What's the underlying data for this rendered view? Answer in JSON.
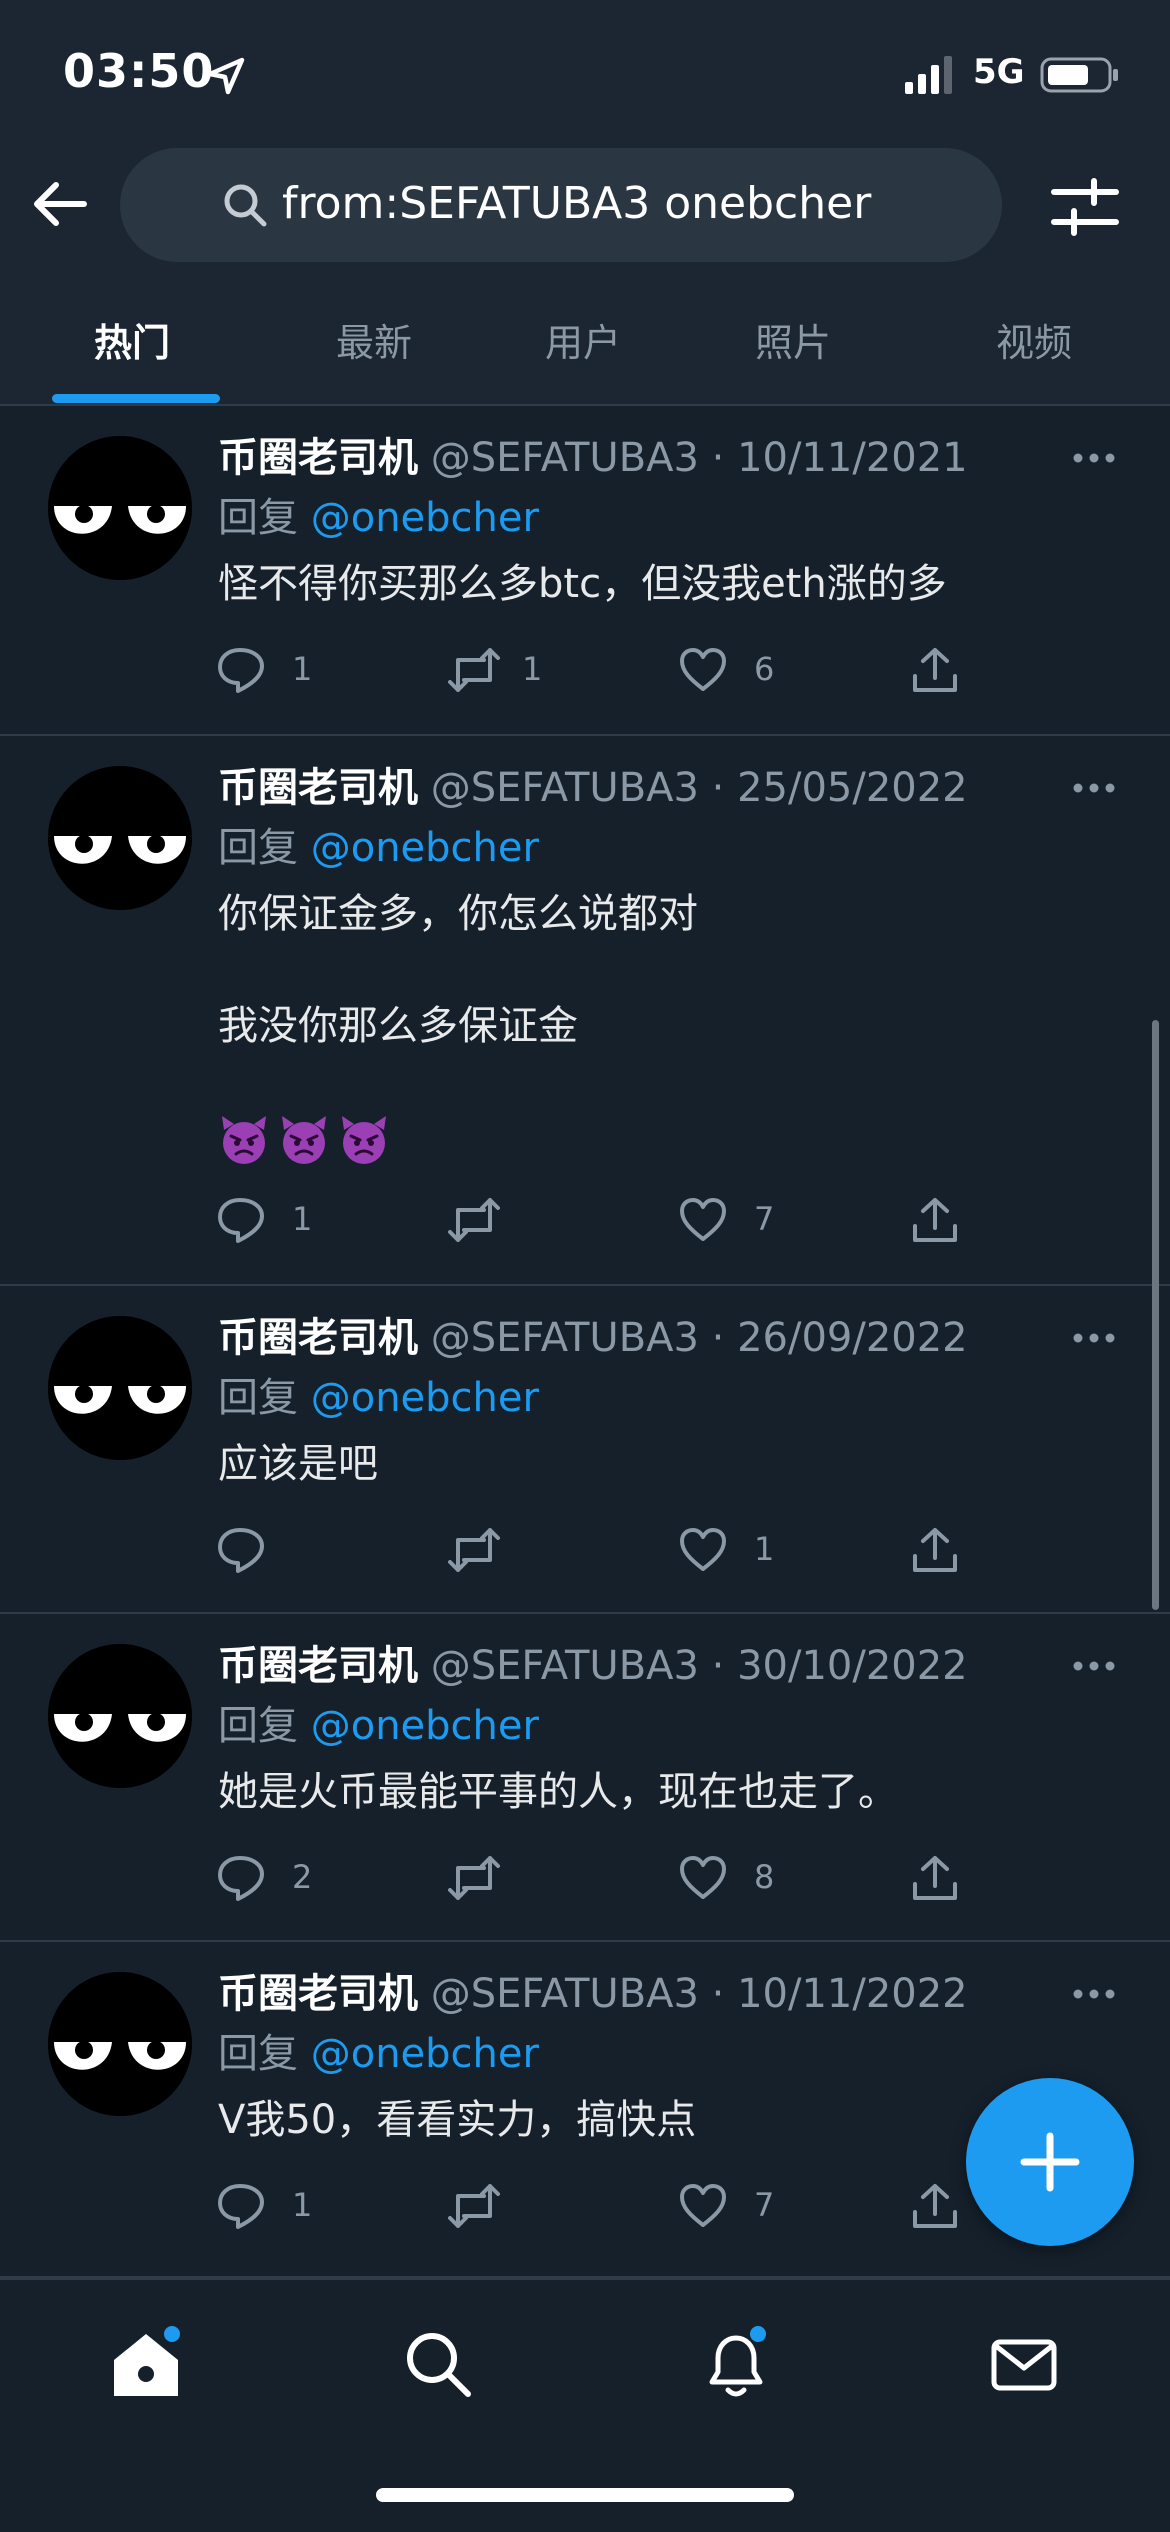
{
  "status_bar": {
    "time": "03:50",
    "network": "5G"
  },
  "search": {
    "query": "from:SEFATUBA3 onebcher"
  },
  "tabs": [
    {
      "label": "热门",
      "active": true
    },
    {
      "label": "最新",
      "active": false
    },
    {
      "label": "用户",
      "active": false
    },
    {
      "label": "照片",
      "active": false
    },
    {
      "label": "视频",
      "active": false
    }
  ],
  "tweets": [
    {
      "display_name": "币圈老司机",
      "meta": "@SEFATUBA3 · 10/11/2021",
      "reply_prefix": "回复",
      "reply_to": "@onebcher",
      "text": [
        "怪不得你买那么多btc，但没我eth涨的多"
      ],
      "replies": "1",
      "retweets": "1",
      "likes": "6"
    },
    {
      "display_name": "币圈老司机",
      "meta": "@SEFATUBA3 · 25/05/2022",
      "reply_prefix": "回复",
      "reply_to": "@onebcher",
      "text": [
        "你保证金多，你怎么说都对",
        "我没你那么多保证金"
      ],
      "emoji": "angry-devil-face x3",
      "replies": "1",
      "retweets": "",
      "likes": "7"
    },
    {
      "display_name": "币圈老司机",
      "meta": "@SEFATUBA3 · 26/09/2022",
      "reply_prefix": "回复",
      "reply_to": "@onebcher",
      "text": [
        "应该是吧"
      ],
      "replies": "",
      "retweets": "",
      "likes": "1"
    },
    {
      "display_name": "币圈老司机",
      "meta": "@SEFATUBA3 · 30/10/2022",
      "reply_prefix": "回复",
      "reply_to": "@onebcher",
      "text": [
        "她是火币最能平事的人，现在也走了。"
      ],
      "replies": "2",
      "retweets": "",
      "likes": "8"
    },
    {
      "display_name": "币圈老司机",
      "meta": "@SEFATUBA3 · 10/11/2022",
      "reply_prefix": "回复",
      "reply_to": "@onebcher",
      "text": [
        "V我50，看看实力，搞快点"
      ],
      "replies": "1",
      "retweets": "",
      "likes": "7"
    }
  ],
  "nav": {
    "items": [
      "home-icon",
      "search-icon",
      "notifications-icon",
      "messages-icon"
    ],
    "unread_dots": [
      "home",
      "notifications"
    ]
  },
  "colors": {
    "background": "#15202b",
    "header": "#1b2632",
    "accent": "#1d9bf0",
    "secondary_text": "#8b98a5"
  }
}
